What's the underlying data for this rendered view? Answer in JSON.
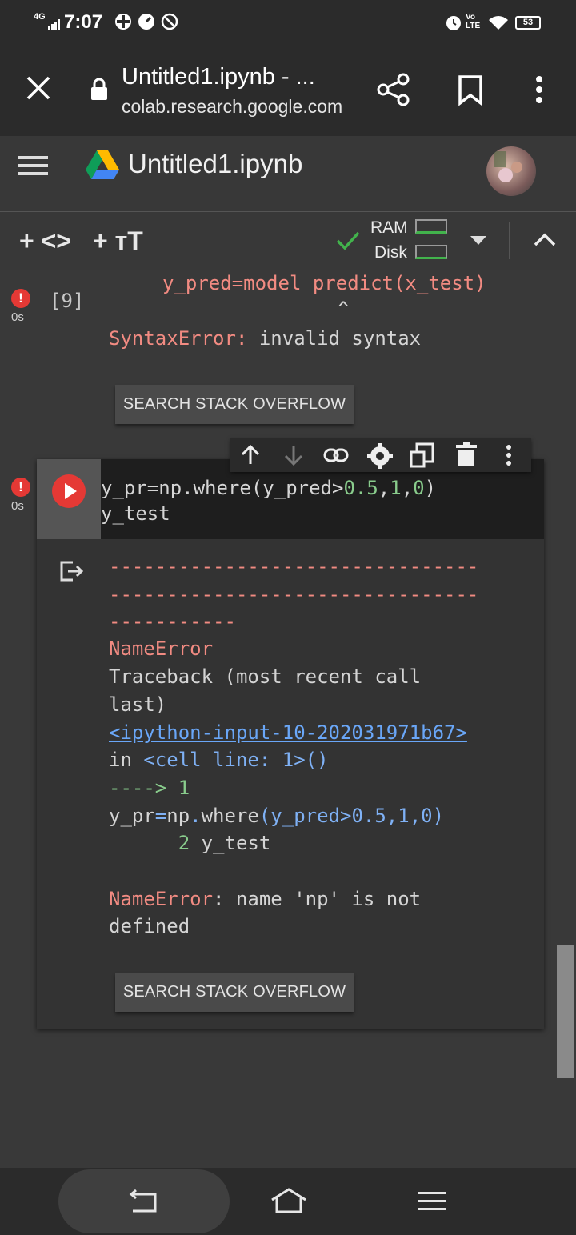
{
  "status_bar": {
    "network": "4G",
    "time": "7:07",
    "lte": "Vo LTE",
    "battery": "53"
  },
  "browser": {
    "page_title": "Untitled1.ipynb - ...",
    "domain": "colab.research.google.com"
  },
  "colab": {
    "notebook_title": "Untitled1.ipynb"
  },
  "toolbar": {
    "add_code": "+ <>",
    "add_text": "+ ᴛT",
    "ram_label": "RAM",
    "disk_label": "Disk"
  },
  "cell1": {
    "exec_count": "[9]",
    "exec_time": "0s",
    "output_code_line": "y_pred=model predict(x_test)",
    "caret": "^",
    "error_type": "SyntaxError:",
    "error_msg": " invalid syntax",
    "so_button": "SEARCH STACK OVERFLOW"
  },
  "cell2": {
    "exec_time": "0s",
    "code_line1_a": "y_pr=np.where(y_pred>",
    "code_line1_num": "0.5",
    "code_line1_b": ",",
    "code_line1_num2": "1",
    "code_line1_c": ",",
    "code_line1_num3": "0",
    "code_line1_d": ")",
    "code_line2": "y_test",
    "dashes1": "--------------------------------",
    "dashes2": "--------------------------------",
    "dashes3": "-----------",
    "error_name": "NameError",
    "traceback1": "Traceback (most recent call",
    "traceback2": "last)",
    "input_link": "<ipython-input-10-202031971b67>",
    "in_text": "in ",
    "cell_line": "<cell line: 1>()",
    "arrow": "----> 1",
    "tb_code_a": "y_pr",
    "tb_code_eq": "=",
    "tb_code_b": "np",
    "tb_code_dot": ".",
    "tb_code_c": "where",
    "tb_code_d": "(y_pred>0.5,1,0)",
    "tb_line2_num": "      2",
    "tb_line2_code": " y_test",
    "final_err_type": "NameError",
    "final_err_msg": ": name 'np' is not",
    "final_err_msg2": "defined",
    "so_button": "SEARCH STACK OVERFLOW"
  },
  "colors": {
    "error_red": "#e53935",
    "ok_green": "#42b34c",
    "link_blue": "#6aa7f8"
  }
}
